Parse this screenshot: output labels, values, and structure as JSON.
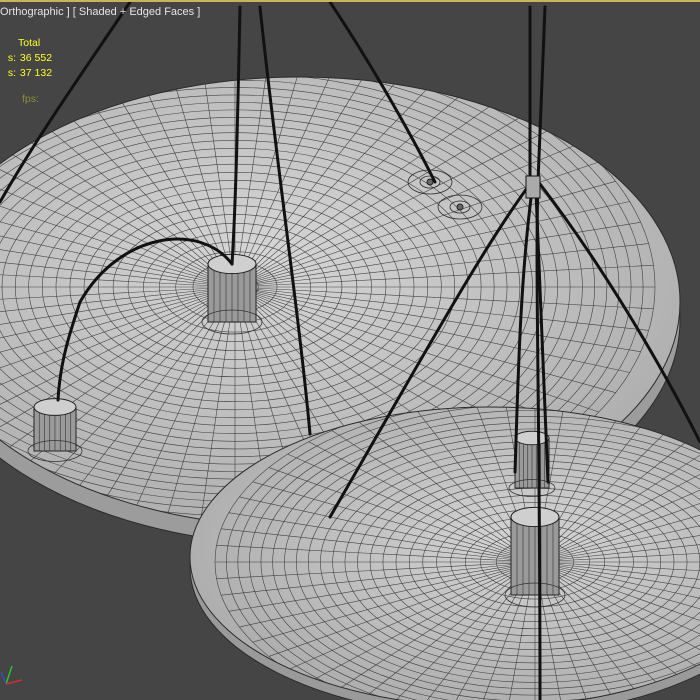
{
  "viewport": {
    "label_view": "Orthographic ]",
    "label_mode": "[ Shaded + Edged Faces ]",
    "border_color": "#c9b45a",
    "background": "#454545"
  },
  "stats": {
    "header": "Total",
    "rows": [
      {
        "key": "s:",
        "value": "36 552"
      },
      {
        "key": "s:",
        "value": "37 132"
      }
    ],
    "fps": "fps:"
  },
  "colors": {
    "mesh_fill": "#c8c8c8",
    "mesh_wire": "#2b2b2b",
    "cable": "#111111",
    "stats_text": "#ffff28",
    "label_text": "#e6e6e6",
    "axis_x": "#d03030",
    "axis_y": "#30c030"
  },
  "icons": {
    "axis_gizmo": "axis-tripod-icon"
  }
}
